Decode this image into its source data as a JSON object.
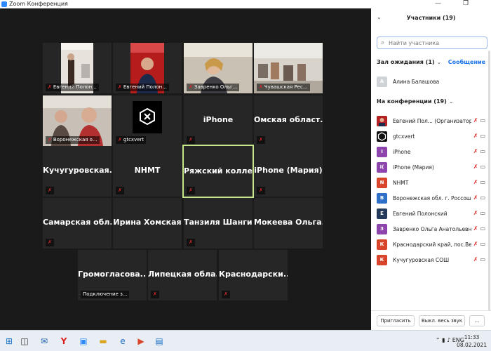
{
  "window": {
    "title": "Zoom Конференция"
  },
  "tiles": [
    {
      "label": "Евгений Полон..."
    },
    {
      "label": "Евгений Полон..."
    },
    {
      "label": "Завренко Ольг..."
    },
    {
      "label": "Чувашская Рес..."
    },
    {
      "label": "Воронежская о..."
    },
    {
      "label": "gtcxvert"
    },
    {
      "name": "iPhone"
    },
    {
      "name": "Омская област..."
    },
    {
      "name": "Кучугуровская..."
    },
    {
      "name": "NHMT"
    },
    {
      "name": "Ряжский колле..."
    },
    {
      "name": "iPhone (Мария)"
    },
    {
      "name": "Самарская обл..."
    },
    {
      "name": "Ирина Хомская"
    },
    {
      "name": "Танзиля Шанги..."
    },
    {
      "name": "Мокеева Ольга..."
    },
    {
      "name": "Громогласова..."
    },
    {
      "name": "Липецкая обла..."
    },
    {
      "name": "Краснодарски..."
    }
  ],
  "connecting_label": "Подключение з...",
  "sidebar": {
    "title": "Участники (19)",
    "search_placeholder": "Найти участника",
    "waiting_header": "Зал ожидания (1)",
    "message_link": "Сообщение",
    "waiting": [
      {
        "initial": "А",
        "name": "Алина Балашова",
        "color": "#cfd3d8"
      }
    ],
    "conf_header": "На конференции (19)",
    "participants": [
      {
        "initial": "",
        "name": "Евгений Пол... (Организатор, я)",
        "color": "#b22222"
      },
      {
        "initial": "",
        "name": "gtcxvert",
        "color": "#111111"
      },
      {
        "initial": "I",
        "name": "iPhone",
        "color": "#8e44ad"
      },
      {
        "initial": "I(",
        "name": "iPhone (Мария)",
        "color": "#8e44ad"
      },
      {
        "initial": "N",
        "name": "NHMT",
        "color": "#d9452b"
      },
      {
        "initial": "В",
        "name": "Воронежская обл. г. Россошь,",
        "color": "#2e6fc7"
      },
      {
        "initial": "Е",
        "name": "Евгений Полонский",
        "color": "#263a5c"
      },
      {
        "initial": "З",
        "name": "Завренко Ольга Анатольевна",
        "color": "#8e44ad"
      },
      {
        "initial": "К",
        "name": "Краснодарский край, пос.Вен...",
        "color": "#d9452b"
      },
      {
        "initial": "К",
        "name": "Кучугуровская СОШ",
        "color": "#d9452b"
      }
    ],
    "invite_button": "Пригласить",
    "mute_all_button": "Выкл. весь звук",
    "more_button": "..."
  },
  "taskbar": {
    "language": "ENG",
    "time": "11:33",
    "date": "08.02.2021"
  }
}
